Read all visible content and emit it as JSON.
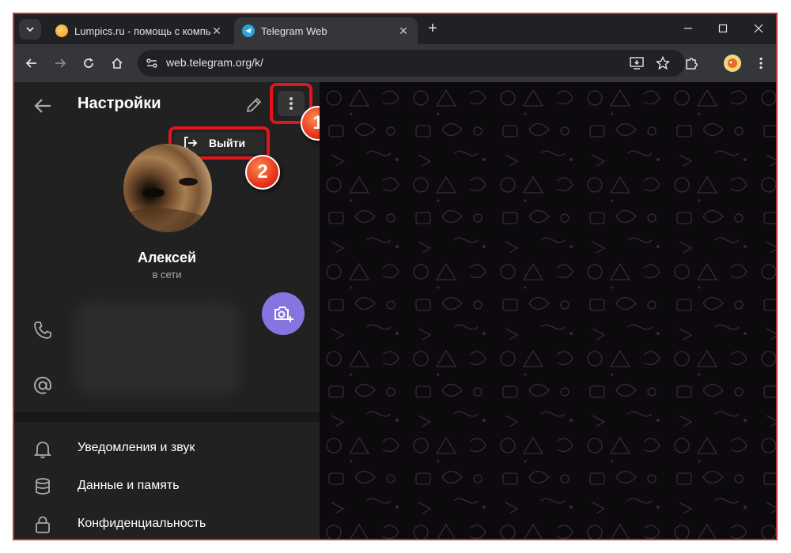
{
  "browser": {
    "tabs": [
      {
        "title": "Lumpics.ru - помощь с компьютером",
        "favicon": "lumpics-favicon",
        "active": false
      },
      {
        "title": "Telegram Web",
        "favicon": "telegram-favicon",
        "active": true
      }
    ],
    "url": "web.telegram.org/k/"
  },
  "settings": {
    "title": "Настройки",
    "menu_item_logout": "Выйти"
  },
  "profile": {
    "name": "Алексей",
    "status": "в сети"
  },
  "settings_menu": [
    {
      "label": "Уведомления и звук",
      "icon": "bell-icon"
    },
    {
      "label": "Данные и память",
      "icon": "database-icon"
    },
    {
      "label": "Конфиденциальность",
      "icon": "lock-icon"
    }
  ],
  "callouts": [
    "1",
    "2"
  ],
  "colors": {
    "accent": "#8774e1",
    "highlight": "#e3141b",
    "sidebar_bg": "#212121",
    "chat_bg": "#0c0a0d"
  }
}
